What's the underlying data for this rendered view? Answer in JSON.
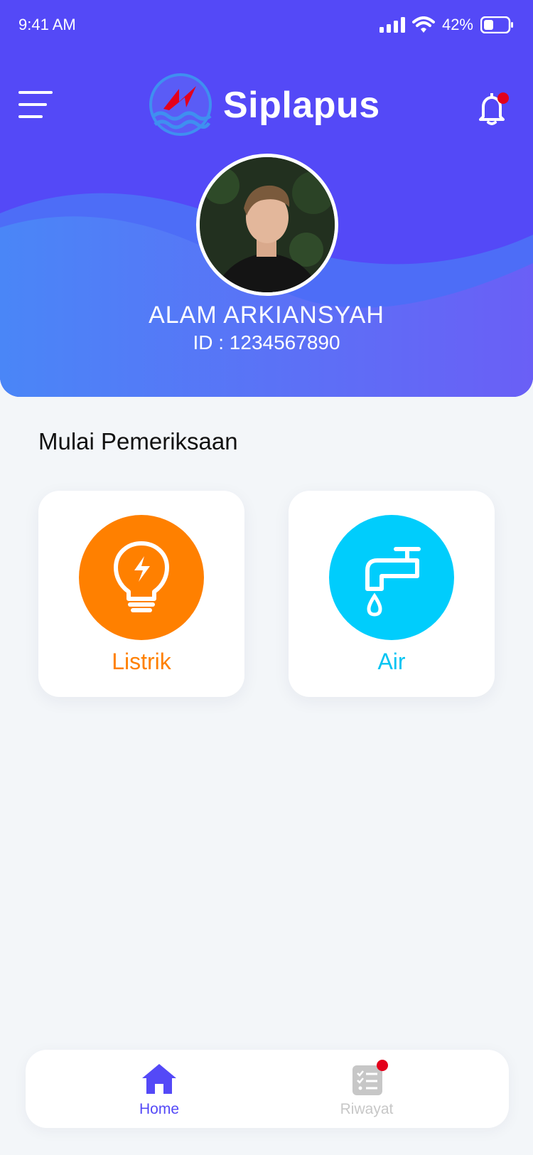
{
  "status_bar": {
    "time": "9:41 AM",
    "battery_pct": "42%",
    "battery_level": 0.42
  },
  "header": {
    "app_title": "Siplapus",
    "has_notification": true
  },
  "profile": {
    "name": "ALAM ARKIANSYAH",
    "id_text": "ID : 1234567890"
  },
  "main": {
    "section_title": "Mulai Pemeriksaan",
    "cards": [
      {
        "label": "Listrik",
        "icon": "lightbulb-icon",
        "color": "#ff8000"
      },
      {
        "label": "Air",
        "icon": "water-tap-icon",
        "color": "#00cdfc"
      }
    ]
  },
  "bottom_nav": {
    "items": [
      {
        "label": "Home",
        "icon": "home-icon",
        "active": true,
        "color": "#5449f7"
      },
      {
        "label": "Riwayat",
        "icon": "history-list-icon",
        "active": false,
        "badge": true,
        "color": "#c7c7c7"
      }
    ]
  },
  "colors": {
    "primary": "#5449f7",
    "secondary_blue": "#4a86f7",
    "badge_red": "#e3001b",
    "background": "#f3f6f9"
  }
}
